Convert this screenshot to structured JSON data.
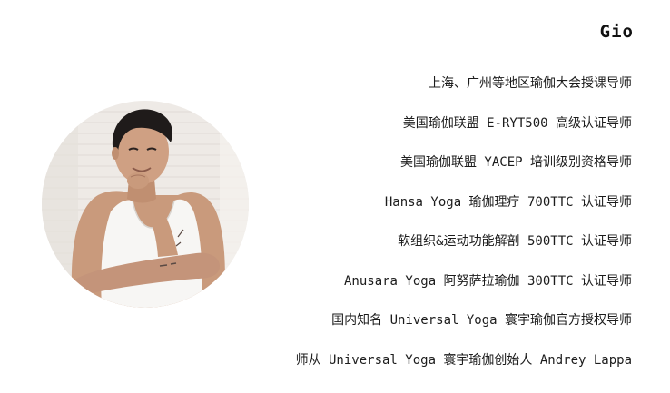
{
  "profile": {
    "name": "Gio",
    "credentials": [
      "上海、广州等地区瑜伽大会授课导师",
      "美国瑜伽联盟 E-RYT500 高级认证导师",
      "美国瑜伽联盟 YACEP 培训级别资格导师",
      "Hansa Yoga 瑜伽理疗 700TTC 认证导师",
      "软组织&运动功能解剖 500TTC 认证导师",
      "Anusara Yoga 阿努萨拉瑜伽 300TTC 认证导师",
      "国内知名 Universal Yoga 寰宇瑜伽官方授权导师",
      "师从 Universal Yoga 寰宇瑜伽创始人 Andrey Lappa"
    ]
  },
  "colors": {
    "text": "#1c1c1c",
    "background": "#ffffff",
    "photo_backdrop": "#eeeae6"
  }
}
